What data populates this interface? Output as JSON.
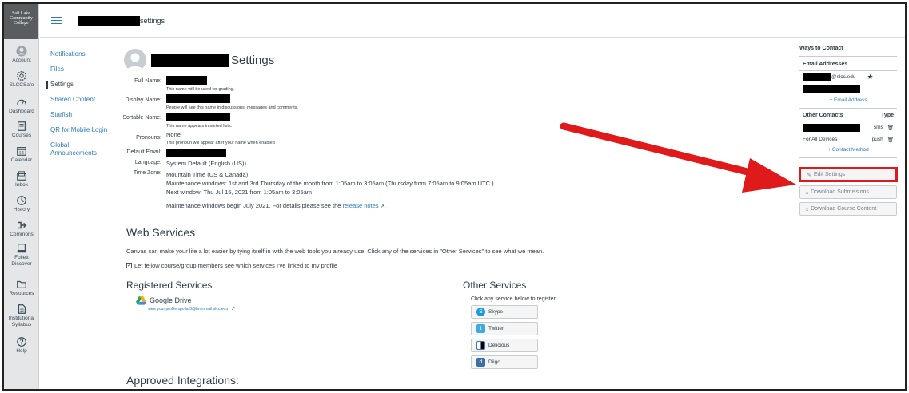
{
  "global_nav": {
    "logo_text": "Salt Lake Community College",
    "items": [
      {
        "label": "Account",
        "icon": "account-icon"
      },
      {
        "label": "SLCCSafe",
        "icon": "gear-badge-icon"
      },
      {
        "label": "Dashboard",
        "icon": "dashboard-icon"
      },
      {
        "label": "Courses",
        "icon": "courses-icon"
      },
      {
        "label": "Calendar",
        "icon": "calendar-icon"
      },
      {
        "label": "Inbox",
        "icon": "inbox-icon"
      },
      {
        "label": "History",
        "icon": "history-icon"
      },
      {
        "label": "Commons",
        "icon": "commons-icon"
      },
      {
        "label": "Follett Discover",
        "icon": "follett-icon"
      },
      {
        "label": "Resources",
        "icon": "folder-icon"
      },
      {
        "label": "Institutional Syllabus",
        "icon": "syllabus-icon"
      },
      {
        "label": "Help",
        "icon": "help-icon"
      }
    ]
  },
  "breadcrumb": {
    "current": "settings"
  },
  "subnav": {
    "items": [
      "Notifications",
      "Files",
      "Settings",
      "Shared Content",
      "Starfish",
      "QR for Mobile Login",
      "Global Announcements"
    ],
    "active_index": 2
  },
  "profile": {
    "title": "Settings",
    "full_name_label": "Full Name:",
    "full_name_hint": "This name will be used for grading.",
    "display_name_label": "Display Name:",
    "display_name_hint": "People will see this name in discussions, messages and comments.",
    "sortable_name_label": "Sortable Name:",
    "sortable_name_hint": "This name appears in sorted lists.",
    "pronouns_label": "Pronouns:",
    "pronouns_value": "None",
    "pronouns_hint": "This pronoun will appear after your name when enabled",
    "default_email_label": "Default Email:",
    "language_label": "Language:",
    "language_value": "System Default (English (US))",
    "timezone_label": "Time Zone:",
    "timezone_value": "Mountain Time (US & Canada)",
    "maintenance_1": "Maintenance windows: 1st and 3rd Thursday of the month from 1:05am to 3:05am (Thursday from 7:05am to 9:05am UTC )",
    "maintenance_2": "Next window: Thu Jul 15, 2021 from 1:05am to 3:05am",
    "maintenance_3_prefix": "Maintenance windows begin July 2021. For details please see the",
    "release_notes_link": "release notes",
    "maintenance_3_suffix": "."
  },
  "web_services": {
    "heading": "Web Services",
    "description": "Canvas can make your life a lot easier by tying itself in with the web tools you already use. Click any of the services in \"Other Services\" to see what we mean.",
    "checkbox_label": "Let fellow course/group members see which services I've linked to my profile",
    "registered_heading": "Registered Services",
    "google_drive_label": "Google Drive",
    "google_drive_link": "view your profile spollar3@bruinmail.slcc.edu",
    "other_heading": "Other Services",
    "other_hint": "Click any service below to register:",
    "other_services": [
      "Skype",
      "Twitter",
      "Delicious",
      "Diigo"
    ],
    "approved_heading": "Approved Integrations:"
  },
  "contact": {
    "heading": "Ways to Contact",
    "email_heading": "Email Addresses",
    "email_suffix": "@slcc.edu",
    "add_email": "+ Email Address",
    "other_contacts_heading": "Other Contacts",
    "type_heading": "Type",
    "sms_type": "sms",
    "devices_label": "For All Devices",
    "push_type": "push",
    "add_contact": "+ Contact Method"
  },
  "actions": {
    "edit_settings": "Edit Settings",
    "download_submissions": "Download Submissions",
    "download_course_content": "Download Course Content"
  },
  "colors": {
    "accent": "#2b7abc",
    "annotation": "#e0191b"
  }
}
